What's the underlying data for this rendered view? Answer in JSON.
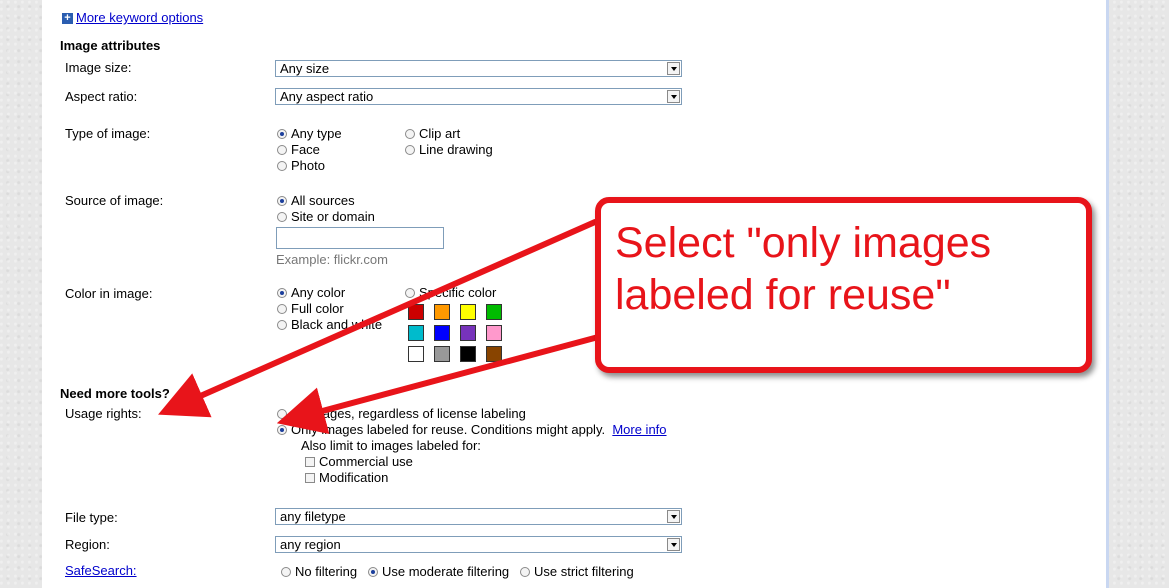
{
  "more_keyword_options": "More keyword options",
  "image_attributes": {
    "heading": "Image attributes",
    "size_label": "Image size:",
    "size_value": "Any size",
    "aspect_label": "Aspect ratio:",
    "aspect_value": "Any aspect ratio",
    "type_label": "Type of image:",
    "type_options": [
      "Any type",
      "Face",
      "Photo",
      "Clip art",
      "Line drawing"
    ],
    "source_label": "Source of image:",
    "source_options": [
      "All sources",
      "Site or domain"
    ],
    "source_example": "Example: flickr.com",
    "color_label": "Color in image:",
    "color_options": [
      "Any color",
      "Full color",
      "Black and white",
      "Specific color"
    ],
    "swatches": [
      "#cc0000",
      "#ff9900",
      "#ffff00",
      "#00bb00",
      "#00bbcc",
      "#0000ff",
      "#7733bb",
      "#ff99cc",
      "#ffffff",
      "#999999",
      "#000000",
      "#884400"
    ]
  },
  "tools": {
    "heading": "Need more tools?",
    "usage_label": "Usage rights:",
    "usage_options": [
      "All images, regardless of license labeling",
      "Only images labeled for reuse. Conditions might apply."
    ],
    "more_info": "More info",
    "also_limit": "Also limit to images labeled for:",
    "limit_options": [
      "Commercial use",
      "Modification"
    ],
    "filetype_label": "File type:",
    "filetype_value": "any filetype",
    "region_label": "Region:",
    "region_value": "any region",
    "safesearch_label": "SafeSearch:",
    "safesearch_options": [
      "No filtering",
      "Use moderate filtering",
      "Use strict filtering"
    ]
  },
  "callout": {
    "line1": "Select \"only images",
    "line2": "labeled for reuse\""
  },
  "colors": {
    "annotation_red": "#e8141a",
    "link_blue": "#0000cc"
  }
}
